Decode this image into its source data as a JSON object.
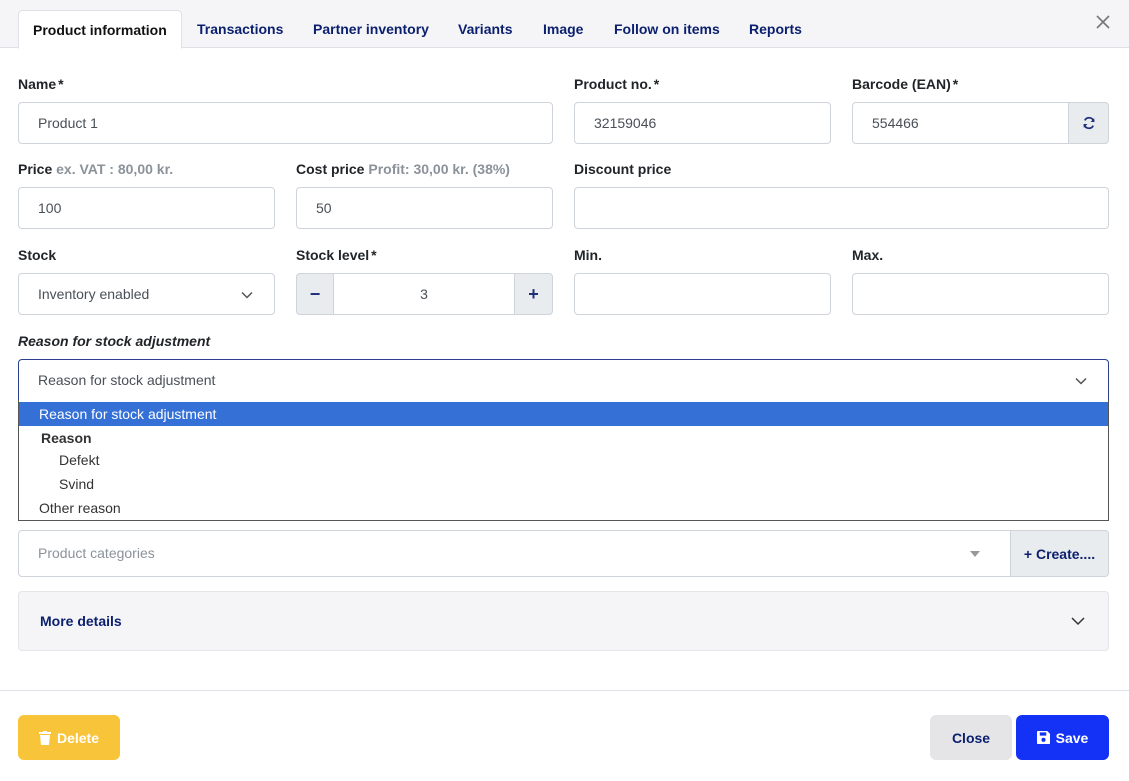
{
  "tabs": [
    {
      "label": "Product information"
    },
    {
      "label": "Transactions"
    },
    {
      "label": "Partner inventory"
    },
    {
      "label": "Variants"
    },
    {
      "label": "Image"
    },
    {
      "label": "Follow on items"
    },
    {
      "label": "Reports"
    }
  ],
  "fields": {
    "name": {
      "label": "Name",
      "value": "Product 1"
    },
    "product_no": {
      "label": "Product no.",
      "value": "32159046"
    },
    "barcode": {
      "label": "Barcode (EAN)",
      "value": "554466"
    },
    "price": {
      "label": "Price",
      "hint": "ex. VAT : 80,00 kr.",
      "value": "100"
    },
    "cost_price": {
      "label": "Cost price",
      "hint": "Profit: 30,00 kr. (38%)",
      "value": "50"
    },
    "discount_price": {
      "label": "Discount price",
      "value": ""
    },
    "stock": {
      "label": "Stock",
      "value": "Inventory enabled"
    },
    "stock_level": {
      "label": "Stock level",
      "value": "3",
      "minus": "−",
      "plus": "+"
    },
    "min": {
      "label": "Min.",
      "value": ""
    },
    "max": {
      "label": "Max.",
      "value": ""
    },
    "reason": {
      "label": "Reason for stock adjustment",
      "value": "Reason for stock adjustment"
    },
    "required_mark": "*"
  },
  "reason_dropdown": {
    "selected": "Reason for stock adjustment",
    "group_label": "Reason",
    "group_options": [
      "Defekt",
      "Svind"
    ],
    "other": "Other reason"
  },
  "categories": {
    "placeholder": "Product categories",
    "create_label": "+ Create...."
  },
  "more_details": {
    "label": "More details"
  },
  "footer": {
    "delete_label": "Delete",
    "close_label": "Close",
    "save_label": "Save"
  },
  "colors": {
    "primary": "#1432f5",
    "danger": "#f8c53a",
    "selected_option": "#3470d6",
    "link": "#0a1f6e"
  },
  "icons": {
    "close": "close-icon",
    "refresh": "refresh-icon",
    "chevron": "chevron-down-icon",
    "trash": "trash-icon",
    "save": "floppy-disk-icon"
  }
}
